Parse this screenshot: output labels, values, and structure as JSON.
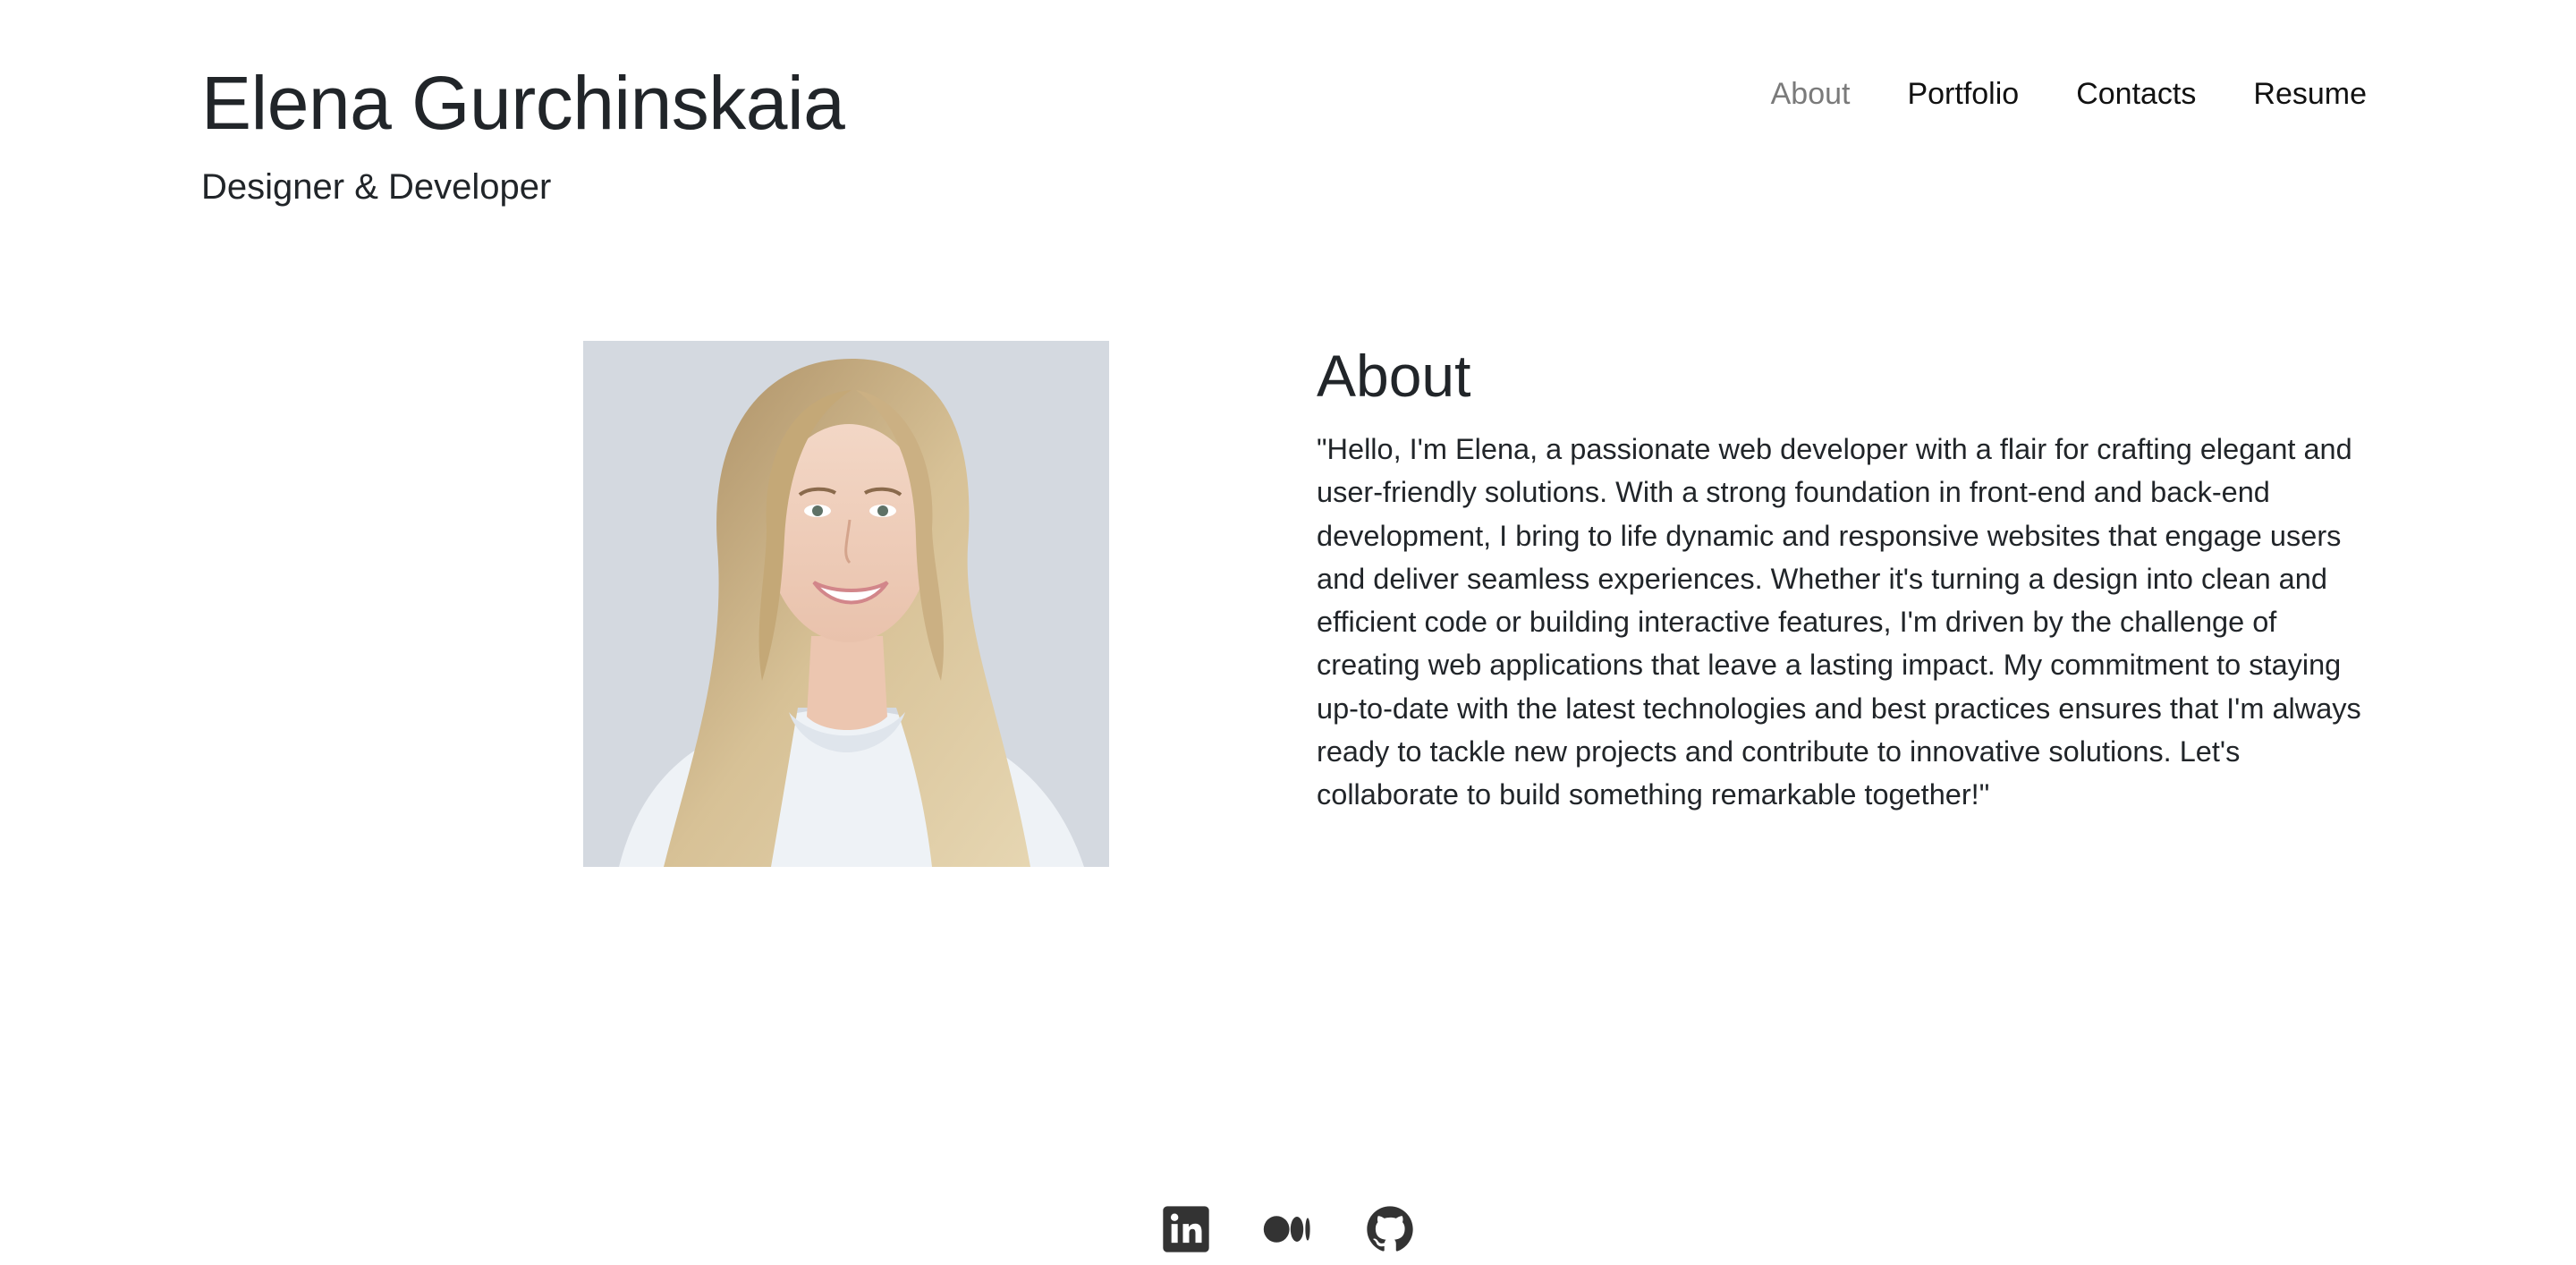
{
  "header": {
    "name": "Elena Gurchinskaia",
    "tagline": "Designer & Developer"
  },
  "nav": {
    "items": [
      {
        "label": "About",
        "active": true
      },
      {
        "label": "Portfolio",
        "active": false
      },
      {
        "label": "Contacts",
        "active": false
      },
      {
        "label": "Resume",
        "active": false
      }
    ]
  },
  "about": {
    "title": "About",
    "text": "\"Hello, I'm Elena, a passionate web developer with a flair for crafting elegant and user-friendly solutions. With a strong foundation in front-end and back-end development, I bring to life dynamic and responsive websites that engage users and deliver seamless experiences. Whether it's turning a design into clean and efficient code or building interactive features, I'm driven by the challenge of creating web applications that leave a lasting impact. My commitment to staying up-to-date with the latest technologies and best practices ensures that I'm always ready to tackle new projects and contribute to innovative solutions. Let's collaborate to build something remarkable together!\""
  },
  "socials": {
    "icons": [
      "linkedin-icon",
      "medium-icon",
      "github-icon"
    ]
  },
  "colors": {
    "text": "#212529",
    "nav_active": "#7a7a7a",
    "icon": "#333333",
    "photo_background": "#d4d9e0"
  }
}
